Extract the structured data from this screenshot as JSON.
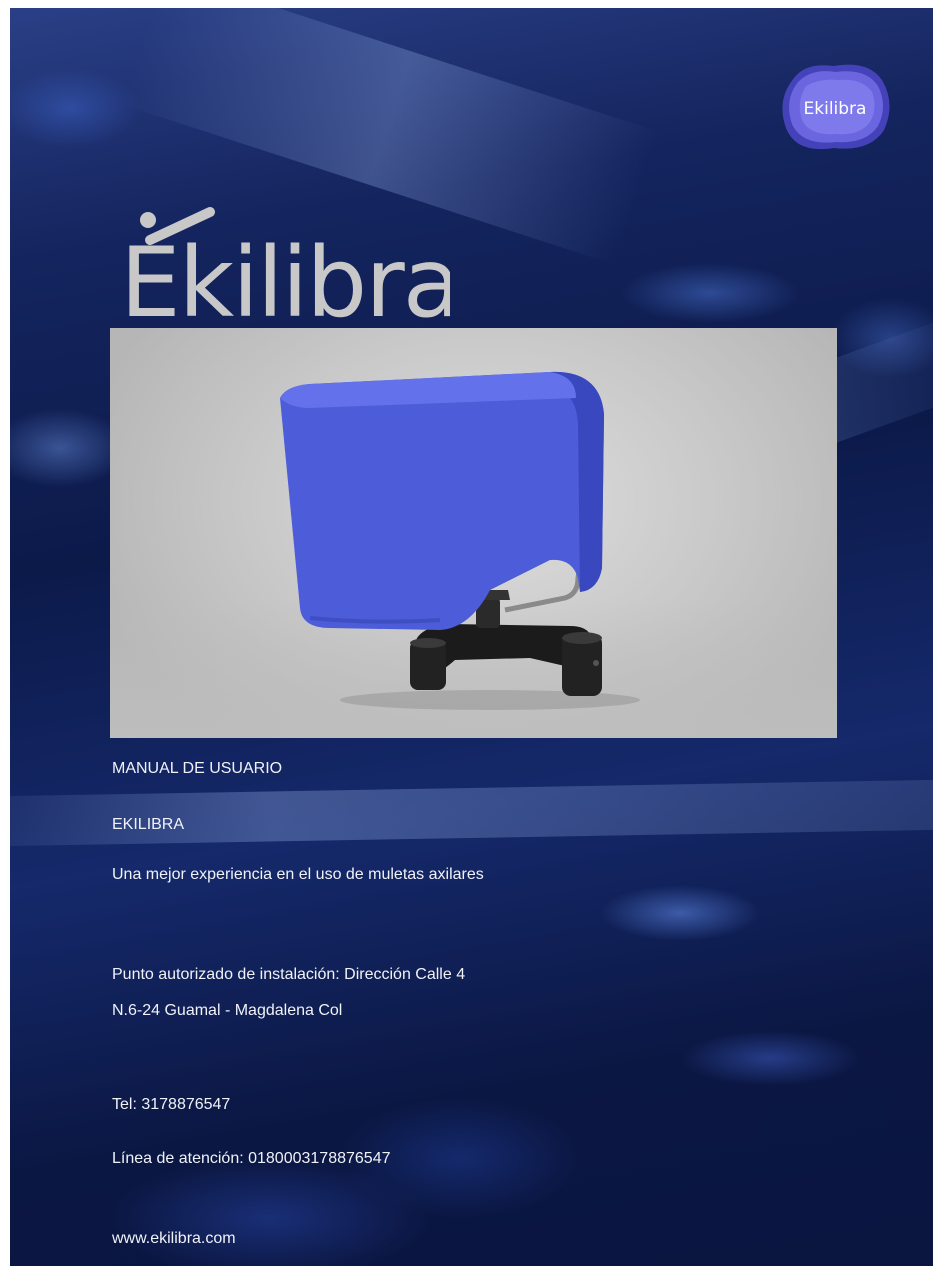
{
  "badge": {
    "text": "Ekilibra",
    "colors": {
      "fill": "#5a55d8",
      "fill_light": "#7b76e6"
    }
  },
  "wordmark": {
    "text": "Ekilibra",
    "color": "#c8c8c8"
  },
  "product_image": {
    "description": "blue crutch pad",
    "colors": {
      "pad": "#5161e0",
      "base": "#1b1b1b"
    }
  },
  "cover": {
    "title": "MANUAL DE USUARIO",
    "subtitle": "EKILIBRA",
    "tagline": "Una mejor experiencia en el uso de muletas axilares",
    "address_line1": "Punto autorizado de instalación: Dirección Calle 4",
    "address_line2": "N.6-24 Guamal - Magdalena Col",
    "phone": "Tel: 3178876547",
    "hotline": "Línea de atención: 0180003178876547",
    "website": "www.ekilibra.com"
  }
}
